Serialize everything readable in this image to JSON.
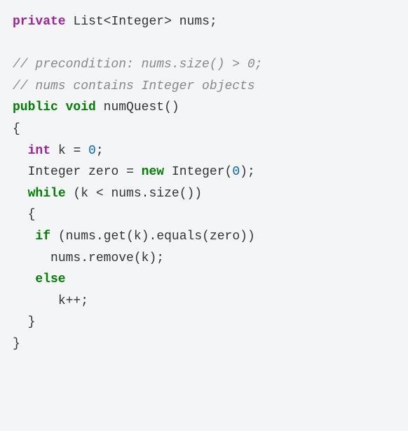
{
  "code": {
    "line1": {
      "kw_private": "private",
      "type_list": "List",
      "lt": "<",
      "type_integer": "Integer",
      "gt": ">",
      "space": " ",
      "ident_nums": "nums",
      "semi": ";"
    },
    "line2": "",
    "line3": {
      "comment": "// precondition: nums.size() > 0;"
    },
    "line4": {
      "comment": "// nums contains Integer objects"
    },
    "line5": {
      "kw_public": "public",
      "kw_void": "void",
      "method": "numQuest",
      "parens": "()"
    },
    "line6": {
      "brace": "{"
    },
    "line7": {
      "kw_int": "int",
      "ident_k": "k",
      "eq": " = ",
      "val": "0",
      "semi": ";"
    },
    "line8": {
      "type_integer": "Integer",
      "ident_zero": "zero",
      "eq": " = ",
      "kw_new": "new",
      "ctor": "Integer",
      "lparen": "(",
      "arg": "0",
      "rparen": ")",
      "semi": ";"
    },
    "line9": {
      "kw_while": "while",
      "lparen": " (",
      "ident_k": "k",
      "lt": " < ",
      "ident_nums": "nums",
      "dot": ".",
      "method_size": "size",
      "parens": "()",
      "rparen": ")"
    },
    "line10": {
      "brace": "{"
    },
    "line11": {
      "kw_if": "if",
      "lparen": " (",
      "ident_nums": "nums",
      "dot1": ".",
      "method_get": "get",
      "lp2": "(",
      "ident_k": "k",
      "rp2": ")",
      "dot2": ".",
      "method_equals": "equals",
      "lp3": "(",
      "ident_zero": "zero",
      "rp3": ")",
      "rparen": ")"
    },
    "line12": {
      "ident_nums": "nums",
      "dot": ".",
      "method_remove": "remove",
      "lp": "(",
      "ident_k": "k",
      "rp": ")",
      "semi": ";"
    },
    "line13": {
      "kw_else": "else"
    },
    "line14": {
      "ident_k": "k",
      "inc": "++",
      "semi": ";"
    },
    "line15": {
      "brace": "}"
    },
    "line16": {
      "brace": "}"
    }
  }
}
